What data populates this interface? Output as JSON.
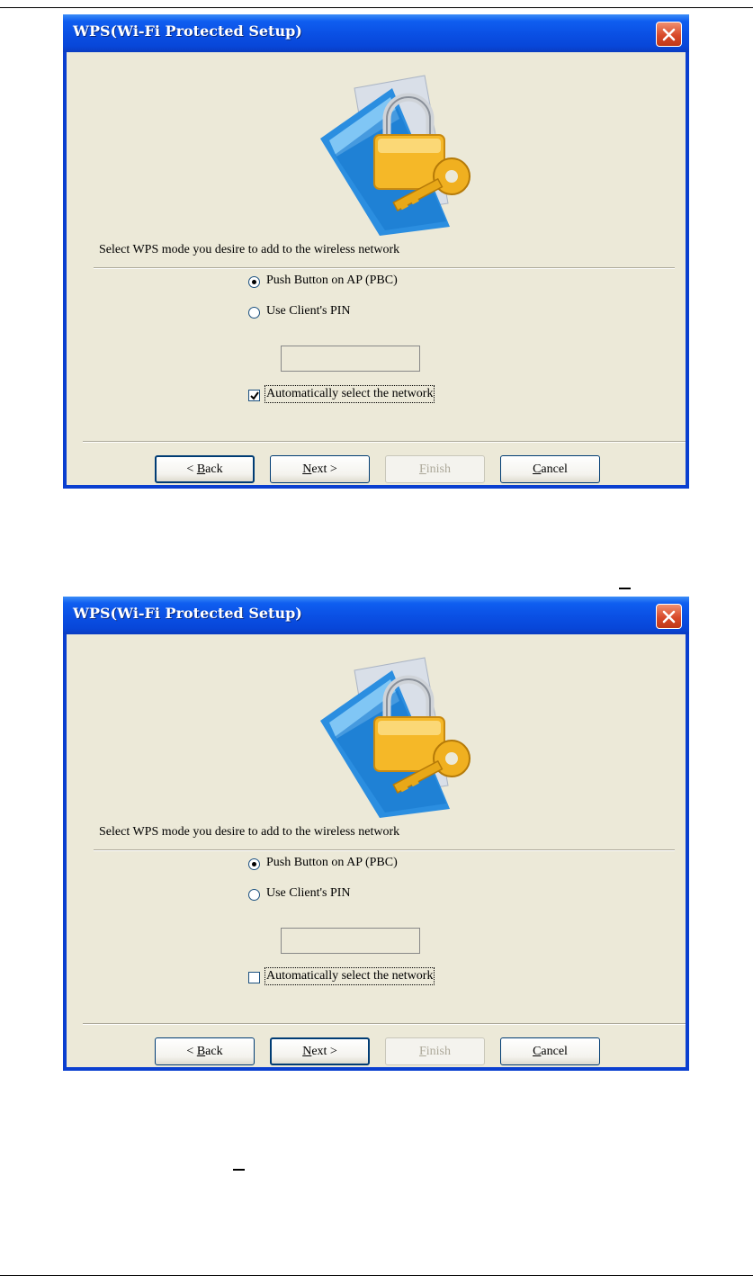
{
  "dialogs": [
    {
      "title": "WPS(Wi-Fi Protected Setup)",
      "prompt": "Select WPS mode you desire to add to the wireless network",
      "options": [
        {
          "label": "Push Button on AP (PBC)",
          "selected": true
        },
        {
          "label": "Use Client's PIN",
          "selected": false
        }
      ],
      "pin_value": "",
      "auto_select_label": "Automatically select the network",
      "auto_select_checked": true,
      "buttons": {
        "back": {
          "mnemonic": "B",
          "rest": "ack",
          "prefix": "< "
        },
        "next": {
          "mnemonic": "N",
          "rest": "ext >"
        },
        "finish": {
          "mnemonic": "F",
          "rest": "inish"
        },
        "cancel": {
          "mnemonic": "C",
          "rest": "ancel"
        }
      },
      "default_button": "back"
    },
    {
      "title": "WPS(Wi-Fi Protected Setup)",
      "prompt": "Select WPS mode you desire to add to the wireless network",
      "options": [
        {
          "label": "Push Button on AP (PBC)",
          "selected": true
        },
        {
          "label": "Use Client's PIN",
          "selected": false
        }
      ],
      "pin_value": "",
      "auto_select_label": "Automatically select the network",
      "auto_select_checked": false,
      "buttons": {
        "back": {
          "mnemonic": "B",
          "rest": "ack",
          "prefix": "< "
        },
        "next": {
          "mnemonic": "N",
          "rest": "ext >"
        },
        "finish": {
          "mnemonic": "F",
          "rest": "inish"
        },
        "cancel": {
          "mnemonic": "C",
          "rest": "ancel"
        }
      },
      "default_button": "next"
    }
  ],
  "icons": {
    "close": "close-icon",
    "wps_lock_key": "wps-lock-key-icon",
    "checkmark": "checkmark-icon"
  },
  "colors": {
    "titlebar": "#0a4fe3",
    "close": "#d84a2a",
    "client_bg": "#ece9d8"
  }
}
